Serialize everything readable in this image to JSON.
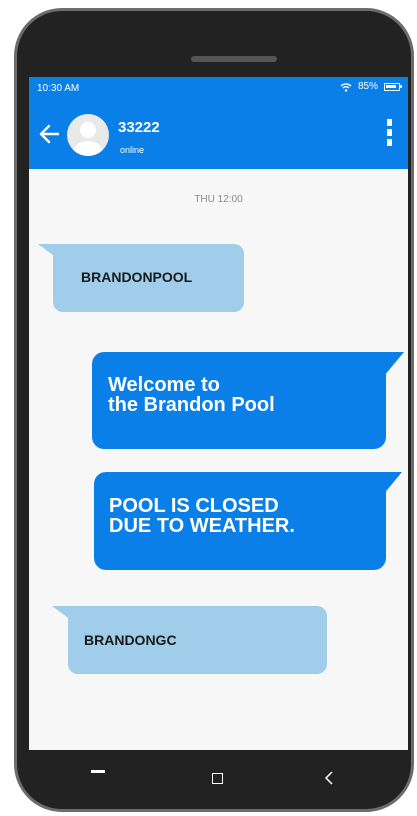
{
  "status_bar": {
    "time": "10:30 AM",
    "battery": "85%"
  },
  "header": {
    "contact_name": "33222",
    "contact_status": "online"
  },
  "conversation": {
    "date_label": "THU 12:00",
    "messages": [
      {
        "direction": "incoming",
        "text": "BRANDONPOOL"
      },
      {
        "direction": "outgoing",
        "text": "Welcome to\nthe Brandon Pool"
      },
      {
        "direction": "outgoing",
        "text": "POOL IS CLOSED\nDUE TO WEATHER."
      },
      {
        "direction": "incoming",
        "text": "BRANDONGC"
      }
    ]
  },
  "colors": {
    "accent": "#0b7fe8",
    "incoming_bubble": "#9fcdea",
    "phone_body": "#222222"
  },
  "icons": [
    "wifi-icon",
    "battery-icon",
    "back-arrow-icon",
    "avatar-icon",
    "overflow-menu-icon",
    "nav-recent-icon",
    "nav-home-icon",
    "nav-back-icon"
  ]
}
